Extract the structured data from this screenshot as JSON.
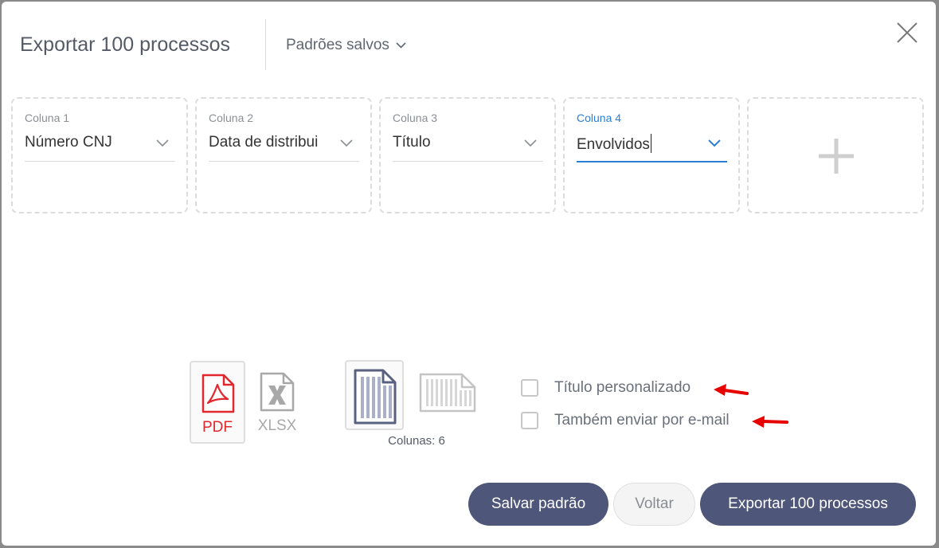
{
  "header": {
    "title": "Exportar 100 processos",
    "saved_patterns_label": "Padrões salvos"
  },
  "columns": [
    {
      "label": "Coluna 1",
      "value": "Número CNJ",
      "active": false
    },
    {
      "label": "Coluna 2",
      "value": "Data de distribui",
      "active": false
    },
    {
      "label": "Coluna 3",
      "value": "Título",
      "active": false
    },
    {
      "label": "Coluna 4",
      "value": "Envolvidos",
      "active": true
    }
  ],
  "formats": {
    "pdf_label": "PDF",
    "xlsx_label": "XLSX",
    "selected": "PDF"
  },
  "layout": {
    "columns_label": "Colunas: 6",
    "selected": "portrait"
  },
  "options": {
    "custom_title_label": "Título personalizado",
    "send_email_label": "Também enviar por e-mail"
  },
  "buttons": {
    "save_label": "Salvar padrão",
    "back_label": "Voltar",
    "export_label": "Exportar 100 processos"
  },
  "colors": {
    "primary": "#4e5679",
    "accent": "#2a7fd4",
    "pdf_red": "#e0282e",
    "arrow_red": "#e60000"
  },
  "icons": [
    "chevron-down-icon",
    "close-icon",
    "plus-icon",
    "pdf-icon",
    "xlsx-icon",
    "portrait-layout-icon",
    "landscape-layout-icon"
  ]
}
